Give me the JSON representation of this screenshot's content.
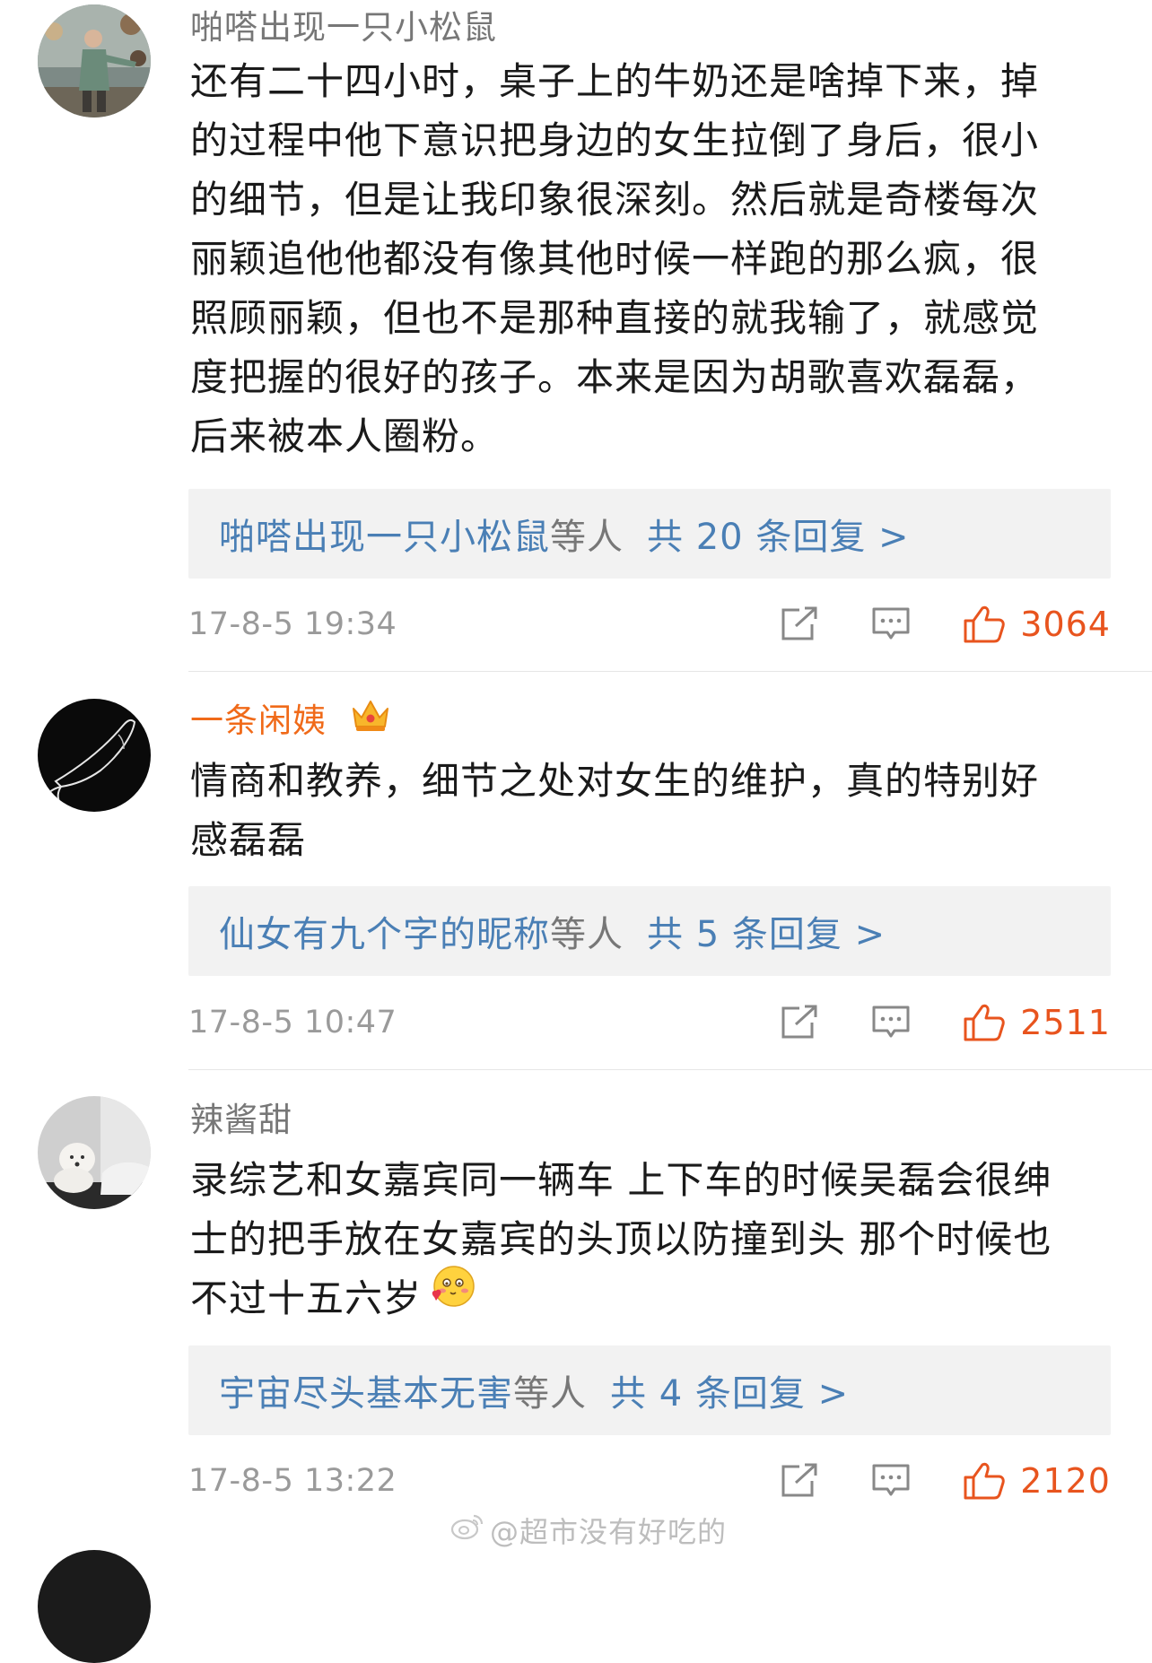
{
  "comments": [
    {
      "username": "啪嗒出现一只小松鼠",
      "vip": false,
      "lines": [
        "还有二十四小时，桌子上的牛奶还是啥掉下来，掉",
        "的过程中他下意识把身边的女生拉倒了身后，很小",
        "的细节，但是让我印象很深刻。然后就是奇楼每次",
        "丽颖追他他都没有像其他时候一样跑的那么疯，很",
        "照顾丽颖，但也不是那种直接的就我输了，就感觉",
        "度把握的很好的孩子。本来是因为胡歌喜欢磊磊，",
        "后来被本人圈粉。"
      ],
      "reply": {
        "name": "啪嗒出现一只小松鼠",
        "mid": "等人",
        "count": "共 20 条回复 >"
      },
      "time": "17-8-5 19:34",
      "likes": "3064"
    },
    {
      "username": "一条闲姨",
      "vip": true,
      "lines": [
        "情商和教养，细节之处对女生的维护，真的特别好",
        "感磊磊"
      ],
      "reply": {
        "name": "仙女有九个字的昵称",
        "mid": "等人",
        "count": "共 5 条回复 >"
      },
      "time": "17-8-5 10:47",
      "likes": "2511"
    },
    {
      "username": "辣酱甜",
      "vip": false,
      "lines": [
        "录综艺和女嘉宾同一辆车 上下车的时候吴磊会很绅",
        "士的把手放在女嘉宾的头顶以防撞到头 那个时候也",
        "不过十五六岁"
      ],
      "reply": {
        "name": "宇宙尽头基本无害",
        "mid": "等人",
        "count": "共 4 条回复 >"
      },
      "time": "17-8-5 13:22",
      "likes": "2120"
    }
  ],
  "watermark": "@超市没有好吃的",
  "icons": {
    "share": "share-icon",
    "comment": "comment-icon",
    "like": "thumbs-up-icon",
    "crown": "crown-icon",
    "emoji": "blush-emoji-icon",
    "weibo": "weibo-logo-icon"
  },
  "colors": {
    "link": "#4a7fb5",
    "like": "#e8541e",
    "vip_name": "#f06a19",
    "meta": "#9a9a9a",
    "reply_bg": "#f2f2f2"
  }
}
